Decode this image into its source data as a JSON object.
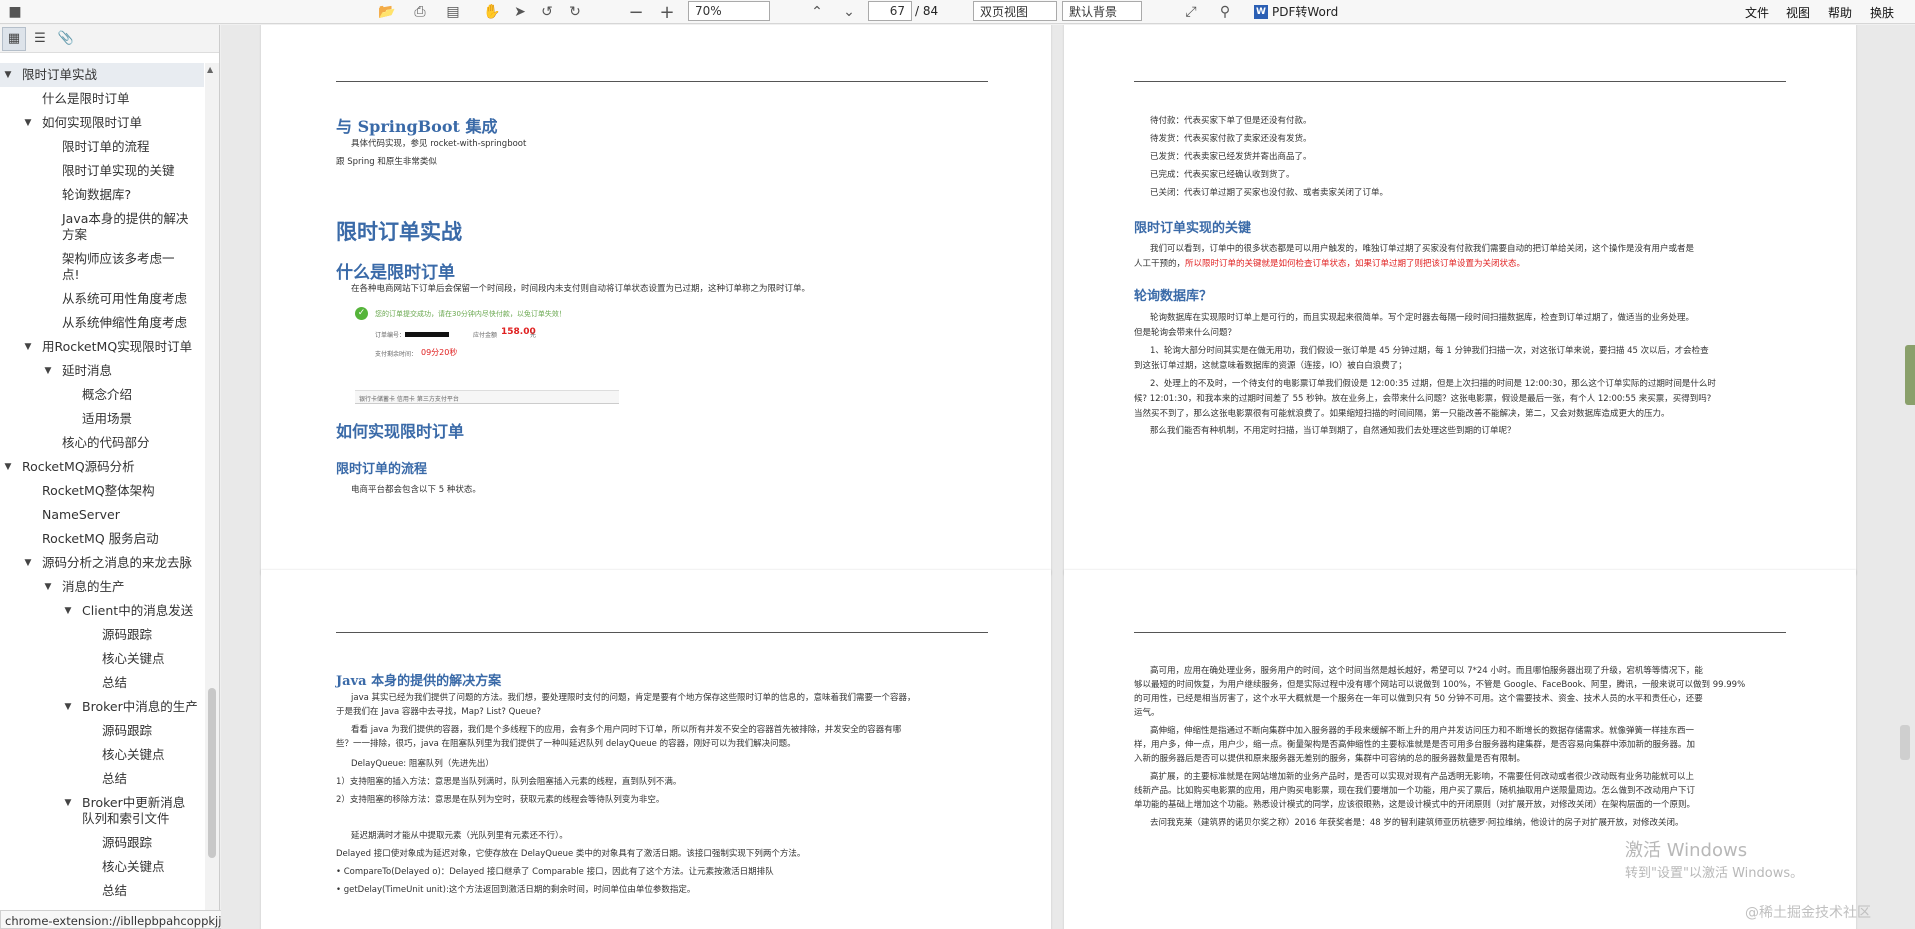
{
  "toolbar": {
    "zoom": "70%",
    "current_page": "67",
    "total_pages": "/ 84",
    "view_mode": "双页视图",
    "background": "默认背景",
    "pdf_to_word": "PDF转Word",
    "menus": [
      "文件",
      "视图",
      "帮助",
      "换肤"
    ]
  },
  "sidebar": {
    "outline": [
      {
        "label": "限时订单实战",
        "level": 0,
        "arrow": "▼",
        "selected": true
      },
      {
        "label": "什么是限时订单",
        "level": 1,
        "arrow": ""
      },
      {
        "label": "如何实现限时订单",
        "level": 1,
        "arrow": "▼"
      },
      {
        "label": "限时订单的流程",
        "level": 2,
        "arrow": ""
      },
      {
        "label": "限时订单实现的关键",
        "level": 2,
        "arrow": ""
      },
      {
        "label": "轮询数据库?",
        "level": 2,
        "arrow": ""
      },
      {
        "label": "Java本身的提供的解决方案",
        "level": 2,
        "arrow": "",
        "two": true
      },
      {
        "label": "架构师应该多考虑一点!",
        "level": 2,
        "arrow": "",
        "two": true
      },
      {
        "label": "从系统可用性角度考虑",
        "level": 2,
        "arrow": ""
      },
      {
        "label": "从系统伸缩性角度考虑",
        "level": 2,
        "arrow": ""
      },
      {
        "label": "用RocketMQ实现限时订单",
        "level": 1,
        "arrow": "▼"
      },
      {
        "label": "延时消息",
        "level": 2,
        "arrow": "▼"
      },
      {
        "label": "概念介绍",
        "level": 3,
        "arrow": ""
      },
      {
        "label": "适用场景",
        "level": 3,
        "arrow": ""
      },
      {
        "label": "核心的代码部分",
        "level": 2,
        "arrow": ""
      },
      {
        "label": "RocketMQ源码分析",
        "level": 0,
        "arrow": "▼"
      },
      {
        "label": "RocketMQ整体架构",
        "level": 1,
        "arrow": ""
      },
      {
        "label": "NameServer",
        "level": 1,
        "arrow": ""
      },
      {
        "label": "RocketMQ 服务启动",
        "level": 1,
        "arrow": ""
      },
      {
        "label": "源码分析之消息的来龙去脉",
        "level": 1,
        "arrow": "▼"
      },
      {
        "label": "消息的生产",
        "level": 2,
        "arrow": "▼"
      },
      {
        "label": "Client中的消息发送",
        "level": 3,
        "arrow": "▼"
      },
      {
        "label": "源码跟踪",
        "level": 4,
        "arrow": ""
      },
      {
        "label": "核心关键点",
        "level": 4,
        "arrow": ""
      },
      {
        "label": "总结",
        "level": 4,
        "arrow": ""
      },
      {
        "label": "Broker中消息的生产",
        "level": 3,
        "arrow": "▼"
      },
      {
        "label": "源码跟踪",
        "level": 4,
        "arrow": ""
      },
      {
        "label": "核心关键点",
        "level": 4,
        "arrow": ""
      },
      {
        "label": "总结",
        "level": 4,
        "arrow": ""
      },
      {
        "label": "Broker中更新消息队列和索引文件",
        "level": 3,
        "arrow": "▼",
        "two": true
      },
      {
        "label": "源码跟踪",
        "level": 4,
        "arrow": ""
      },
      {
        "label": "核心关键点",
        "level": 4,
        "arrow": ""
      },
      {
        "label": "总结",
        "level": 4,
        "arrow": ""
      }
    ]
  },
  "statusbar": {
    "url": "chrome-extension://ibllepbpahcoppkjjllbabhnigcbffpi/file:///F:/桌面文件/新建文件夹 (2)/RocketMQ笔记.pdf#..."
  },
  "page1": {
    "h_springboot": "与 SpringBoot 集成",
    "springboot_l1": "具体代码实现，参见 rocket-with-springboot",
    "springboot_l2": "跟 Spring 和原生非常类似",
    "h_main": "限时订单实战",
    "h_what": "什么是限时订单",
    "what_l1": "在各种电商网站下订单后会保留一个时间段，时间段内未支付则自动将订单状态设置为已过期，这种订单称之为限时订单。",
    "order_success": "您的订单提交成功，请在30分钟内尽快付款，以免订单失效！",
    "order_no": "订单编号：",
    "order_amount": "应付金额",
    "order_amount_val": "158.00",
    "order_unit": "元",
    "pay_time": "支付剩余时间：",
    "pay_time_val": "09分20秒",
    "mini_tabs": "银行卡储蓄卡    信用卡    第三方支付平台",
    "h_how": "如何实现限时订单",
    "h_flow": "限时订单的流程",
    "flow_l1": "电商平台都会包含以下 5 种状态。"
  },
  "page2": {
    "s1": "待付款：代表买家下单了但是还没有付款。",
    "s2": "待发货：代表买家付款了卖家还没有发货。",
    "s3": "已发货：代表卖家已经发货并寄出商品了。",
    "s4": "已完成：代表买家已经确认收到货了。",
    "s5": "已关闭：代表订单过期了买家也没付款、或者卖家关闭了订单。",
    "h_key": "限时订单实现的关键",
    "key_l1": "我们可以看到，订单中的很多状态都是可以用户触发的，唯独订单过期了买家没有付款我们需要自动的把订单给关闭，这个操作是没有用户或者是",
    "key_l2a": "人工干预的，",
    "key_l2b": "所以限时订单的关键就是如何检查订单状态，如果订单过期了则把该订单设置为关闭状态。",
    "h_poll": "轮询数据库？",
    "poll_l1": "轮询数据库在实现限时订单上是可行的，而且实现起来很简单。写个定时器去每隔一段时间扫描数据库，检查到订单过期了，做适当的业务处理。",
    "poll_l2": "但是轮询会带来什么问题？",
    "poll_l3": "1、轮询大部分时间其实是在做无用功，我们假设一张订单是 45 分钟过期，每 1 分钟我们扫描一次，对这张订单来说，要扫描 45 次以后，才会检查",
    "poll_l4": "到这张订单过期，这就意味着数据库的资源（连接，IO）被白白浪费了；",
    "poll_l5": "2、处理上的不及时，一个待支付的电影票订单我们假设是 12:00:35 过期，但是上次扫描的时间是 12:00:30，那么这个订单实际的过期时间是什么时",
    "poll_l6": "候? 12:01:30，和我本来的过期时间差了 55 秒钟。放在业务上，会带来什么问题？这张电影票，假设是最后一张，有个人 12:00:55 来买票，买得到吗?",
    "poll_l7": "当然买不到了，那么这张电影票很有可能就浪费了。如果缩短扫描的时间间隔，第一只能改善不能解决，第二，又会对数据库造成更大的压力。",
    "poll_l8": "那么我们能否有种机制，不用定时扫描，当订单到期了，自然通知我们去处理这些到期的订单呢？"
  },
  "page3": {
    "h_java": "Java 本身的提供的解决方案",
    "j1": "java 其实已经为我们提供了问题的方法。我们想，要处理限时支付的问题，肯定是要有个地方保存这些限时订单的信息的，意味着我们需要一个容器，",
    "j2": "于是我们在 Java 容器中去寻找，Map? List? Queue?",
    "j3": "看看 java 为我们提供的容器，我们是个多线程下的应用，会有多个用户同时下订单，所以所有并发不安全的容器首先被排除，并发安全的容器有哪",
    "j4": "些？一一排除，很巧，java 在阻塞队列里为我们提供了一种叫延迟队列 delayQueue 的容器，刚好可以为我们解决问题。",
    "j5": "DelayQueue:    阻塞队列（先进先出）",
    "j6": "1）支持阻塞的插入方法：意思是当队列满时，队列会阻塞插入元素的线程，直到队列不满。",
    "j7": "2）支持阻塞的移除方法：意思是在队列为空时，获取元素的线程会等待队列变为非空。",
    "j8": "延迟期满时才能从中提取元素（光队列里有元素还不行）。",
    "j9": "Delayed 接口使对象成为延迟对象，它使存放在 DelayQueue 类中的对象具有了激活日期。该接口强制实现下列两个方法。",
    "j10": "•    CompareTo(Delayed o)：Delayed 接口继承了 Comparable 接口，因此有了这个方法。让元素按激活日期排队",
    "j11": "•    getDelay(TimeUnit unit):这个方法返回到激活日期的剩余时间，时间单位由单位参数指定。"
  },
  "page4": {
    "a1": "高可用，应用在确处理业务，服务用户的时间，这个时间当然是越长越好，希望可以 7*24 小时。而且哪怕服务器出现了升级，宕机等等情况下，能",
    "a2": "够以最短的时间恢复，为用户继续服务，但是实际过程中没有哪个网站可以说做到 100%，不管是 Google、FaceBook、阿里，腾讯，一般来说可以做到 99.99%",
    "a3": "的可用性，已经是相当厉害了，这个水平大概就是一个服务在一年可以做到只有 50 分钟不可用。这个需要技术、资金、技术人员的水平和责任心，还要",
    "a4": "运气。",
    "b1": "高伸缩，伸缩性是指通过不断向集群中加入服务器的手段来缓解不断上升的用户并发访问压力和不断增长的数据存储需求。就像弹簧一样挂东西一",
    "b2": "样，用户多，伸一点，用户少，缩一点。衡量架构是否高伸缩性的主要标准就是是否可用多台服务器构建集群，是否容易向集群中添加新的服务器。加",
    "b3": "入新的服务器后是否可以提供和原来服务器无差别的服务，集群中可容纳的总的服务器数量是否有限制。",
    "c1": "高扩展，的主要标准就是在网站增加新的业务产品时，是否可以实现对现有产品透明无影响，不需要任何改动或者很少改动既有业务功能就可以上",
    "c2": "线新产品。比如购买电影票的应用，用户购买电影票，现在我们要增加一个功能，用户买了票后，随机抽取用户送限量周边。怎么做到不改动用户下订",
    "c3": "单功能的基础上增加这个功能。熟悉设计模式的同学，应该很眼熟，这是设计模式中的开闭原则（对扩展开放，对修改关闭）在架构层面的一个原则。",
    "d1": "去问我克莱（建筑界的诺贝尔奖之称）2016 年获奖者是：48 岁的智利建筑师亚历杭德罗·阿拉维纳，他设计的房子对扩展开放，对修改关闭。"
  },
  "watermark": {
    "activate_title": "激活 Windows",
    "activate_sub": "转到\"设置\"以激活 Windows。",
    "site": "@稀土掘金技术社区"
  }
}
